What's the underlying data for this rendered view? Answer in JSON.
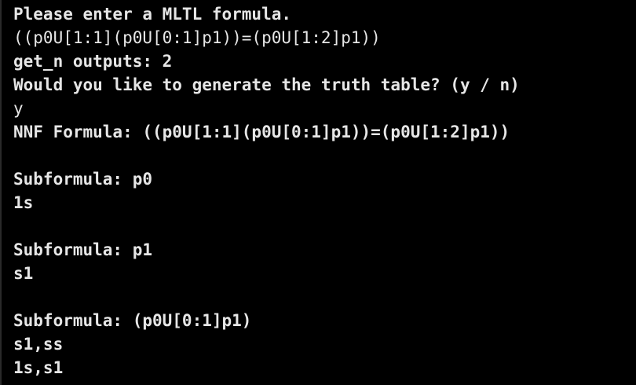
{
  "terminal": {
    "lines": [
      {
        "text": "Please enter a MLTL formula.",
        "weight": "bold"
      },
      {
        "text": "((p0U[1:1](p0U[0:1]p1))=(p0U[1:2]p1))",
        "weight": "normal"
      },
      {
        "text": "get_n outputs: 2",
        "weight": "bold"
      },
      {
        "text": "Would you like to generate the truth table? (y / n)",
        "weight": "bold"
      },
      {
        "text": "y",
        "weight": "normal"
      },
      {
        "text": "NNF Formula: ((p0U[1:1](p0U[0:1]p1))=(p0U[1:2]p1))",
        "weight": "bold"
      },
      {
        "text": "",
        "weight": "bold"
      },
      {
        "text": "Subformula: p0",
        "weight": "bold"
      },
      {
        "text": "1s",
        "weight": "bold"
      },
      {
        "text": "",
        "weight": "bold"
      },
      {
        "text": "Subformula: p1",
        "weight": "bold"
      },
      {
        "text": "s1",
        "weight": "bold"
      },
      {
        "text": "",
        "weight": "bold"
      },
      {
        "text": "Subformula: (p0U[0:1]p1)",
        "weight": "bold"
      },
      {
        "text": "s1,ss",
        "weight": "bold"
      },
      {
        "text": "1s,s1",
        "weight": "bold"
      }
    ]
  },
  "colors": {
    "background": "#000000",
    "foreground": "#e6e6e6"
  }
}
